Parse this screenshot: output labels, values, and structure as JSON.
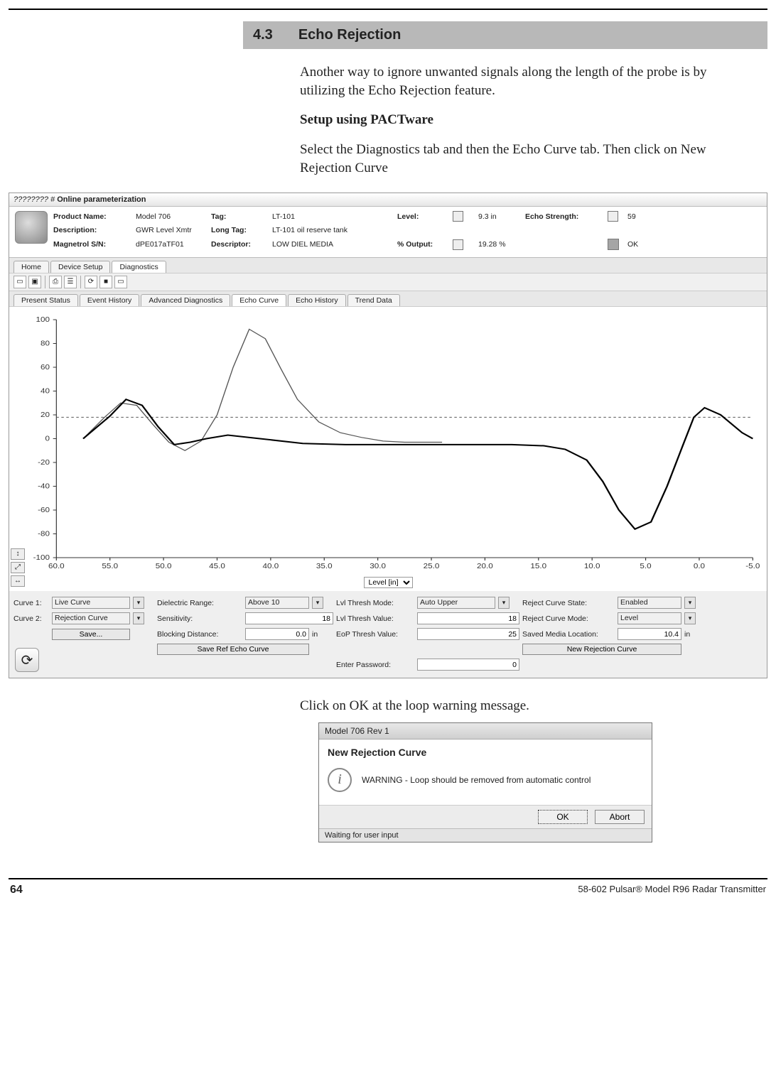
{
  "section": {
    "number": "4.3",
    "title": "Echo Rejection"
  },
  "intro_paragraph": "Another way to ignore unwanted signals along the length of the probe is by utilizing the Echo Rejection feature.",
  "setup_heading": "Setup using PACTware",
  "instructions_paragraph": "Select the Diagnostics tab and then the Echo Curve tab. Then click on New Rejection Curve",
  "pactware": {
    "window_title_prefix": "???????? #",
    "window_title_main": "Online parameterization",
    "header": {
      "product_name_label": "Product Name:",
      "product_name": "Model 706",
      "description_label": "Description:",
      "description": "GWR Level Xmtr",
      "sn_label": "Magnetrol S/N:",
      "sn": "dPE017aTF01",
      "tag_label": "Tag:",
      "tag": "LT-101",
      "long_tag_label": "Long Tag:",
      "long_tag": "LT-101 oil reserve tank",
      "descriptor_label": "Descriptor:",
      "descriptor": "LOW DIEL MEDIA",
      "level_label": "Level:",
      "level_value": "9.3",
      "level_unit": "in",
      "pct_output_label": "% Output:",
      "pct_output_value": "19.28",
      "pct_output_unit": "%",
      "echo_strength_label": "Echo Strength:",
      "echo_strength_value": "59",
      "status_label": "OK"
    },
    "tabs_main": [
      "Home",
      "Device Setup",
      "Diagnostics"
    ],
    "tabs_sub": [
      "Present Status",
      "Event History",
      "Advanced Diagnostics",
      "Echo Curve",
      "Echo History",
      "Trend Data"
    ],
    "axis_selector": "Level [in]",
    "form": {
      "curve1_label": "Curve 1:",
      "curve1_value": "Live Curve",
      "curve2_label": "Curve 2:",
      "curve2_value": "Rejection Curve",
      "save_button": "Save...",
      "dielectric_range_label": "Dielectric Range:",
      "dielectric_range_value": "Above 10",
      "sensitivity_label": "Sensitivity:",
      "sensitivity_value": "18",
      "blocking_distance_label": "Blocking Distance:",
      "blocking_distance_value": "0.0",
      "blocking_distance_unit": "in",
      "save_ref_button": "Save Ref Echo Curve",
      "lvl_thresh_mode_label": "Lvl Thresh Mode:",
      "lvl_thresh_mode_value": "Auto Upper",
      "lvl_thresh_value_label": "Lvl Thresh Value:",
      "lvl_thresh_value_value": "18",
      "eop_thresh_value_label": "EoP Thresh Value:",
      "eop_thresh_value_value": "25",
      "reject_curve_state_label": "Reject Curve State:",
      "reject_curve_state_value": "Enabled",
      "reject_curve_mode_label": "Reject Curve Mode:",
      "reject_curve_mode_value": "Level",
      "saved_media_location_label": "Saved Media Location:",
      "saved_media_location_value": "10.4",
      "saved_media_location_unit": "in",
      "new_rejection_button": "New Rejection Curve",
      "enter_password_label": "Enter Password:",
      "enter_password_value": "0"
    }
  },
  "after_text": "Click on OK at the loop warning message.",
  "dialog": {
    "titlebar": "Model 706 Rev 1",
    "heading": "New Rejection Curve",
    "message": "WARNING - Loop should be removed from automatic control",
    "ok_button": "OK",
    "abort_button": "Abort",
    "status": "Waiting for user input"
  },
  "footer": {
    "page_number": "64",
    "doc_id": "58-602 Pulsar® Model R96 Radar Transmitter"
  },
  "chart_data": {
    "type": "line",
    "xlabel": "Level [in]",
    "ylabel": "",
    "xlim": [
      60,
      -5
    ],
    "ylim": [
      -100,
      100
    ],
    "x_ticks": [
      60.0,
      55.0,
      50.0,
      45.0,
      40.0,
      35.0,
      30.0,
      25.0,
      20.0,
      15.0,
      10.0,
      5.0,
      0.0,
      -5.0
    ],
    "y_ticks": [
      -100,
      -80,
      -60,
      -40,
      -20,
      0,
      20,
      40,
      60,
      80,
      100
    ],
    "threshold_y": 18,
    "series": [
      {
        "name": "Rejection Curve",
        "x": [
          57.5,
          55.5,
          54.0,
          52.5,
          51.0,
          49.5,
          48.0,
          46.5,
          45.0,
          43.5,
          42.0,
          40.5,
          39.0,
          37.5,
          35.5,
          33.5,
          31.5,
          29.5,
          27.5,
          24.0
        ],
        "y": [
          0,
          18,
          30,
          28,
          12,
          -3,
          -10,
          -2,
          20,
          60,
          92,
          84,
          58,
          33,
          14,
          5,
          1,
          -2,
          -3,
          -3
        ]
      },
      {
        "name": "Live Curve",
        "x": [
          57.5,
          55.0,
          53.5,
          52.0,
          50.5,
          49.0,
          47.5,
          46.0,
          44.0,
          41.0,
          37.0,
          33.0,
          29.0,
          25.0,
          21.0,
          17.5,
          14.5,
          12.5,
          10.5,
          9.0,
          7.5,
          6.0,
          4.5,
          3.0,
          1.5,
          0.5,
          -0.5,
          -2.0,
          -4.0,
          -5.0
        ],
        "y": [
          0,
          19,
          33,
          28,
          10,
          -5,
          -3,
          0,
          3,
          0,
          -4,
          -5,
          -5,
          -5,
          -5,
          -5,
          -6,
          -9,
          -18,
          -36,
          -60,
          -76,
          -70,
          -40,
          -5,
          18,
          26,
          20,
          5,
          0
        ]
      }
    ]
  }
}
